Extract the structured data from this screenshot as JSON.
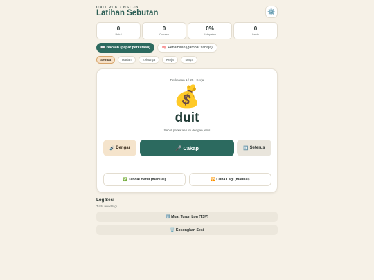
{
  "header": {
    "unit": "UNIT PCK · HSI JB",
    "title": "Latihan Sebutan",
    "settings_icon": "gear-icon"
  },
  "stats": [
    {
      "value": "0",
      "label": "Betul"
    },
    {
      "value": "0",
      "label": "Cubaan"
    },
    {
      "value": "0%",
      "label": "Ketepatan"
    },
    {
      "value": "0",
      "label": "Lenin"
    }
  ],
  "modes": {
    "reading": {
      "icon": "📖",
      "label": "Bacaan (papar perkataan)"
    },
    "recall": {
      "icon": "🧠",
      "label": "Penamaan (gambar sahaja)"
    }
  },
  "filters": [
    "Semua",
    "Harian",
    "Keluarga",
    "Kerja",
    "Tanya"
  ],
  "card": {
    "progress": "Perkataan 1 / 25 · Kerja",
    "emoji": "💰",
    "word": "duit",
    "instruction": "Sebut perkataan ini dengan jelas",
    "listen_icon": "🔊",
    "listen_label": "Dengar",
    "speak_icon": "🎤",
    "speak_label": "Cakap",
    "next_icon": "➡️",
    "next_label": "Seterus",
    "mark_icon": "✅",
    "mark_label": "Tandai Betul (manual)",
    "retry_icon": "🔁",
    "retry_label": "Cuba Lagi (manual)"
  },
  "log": {
    "title": "Log Sesi",
    "empty": "Tiada rekod lagi.",
    "download_icon": "⬇️",
    "download_label": "Muat Turun Log (TSV)",
    "clear_icon": "🗑️",
    "clear_label": "Kosongkan Sesi"
  },
  "colors": {
    "background": "#f6f1e7",
    "accent": "#2c6a5f",
    "title": "#2c5e55",
    "warm_button": "#f5e4cc"
  }
}
